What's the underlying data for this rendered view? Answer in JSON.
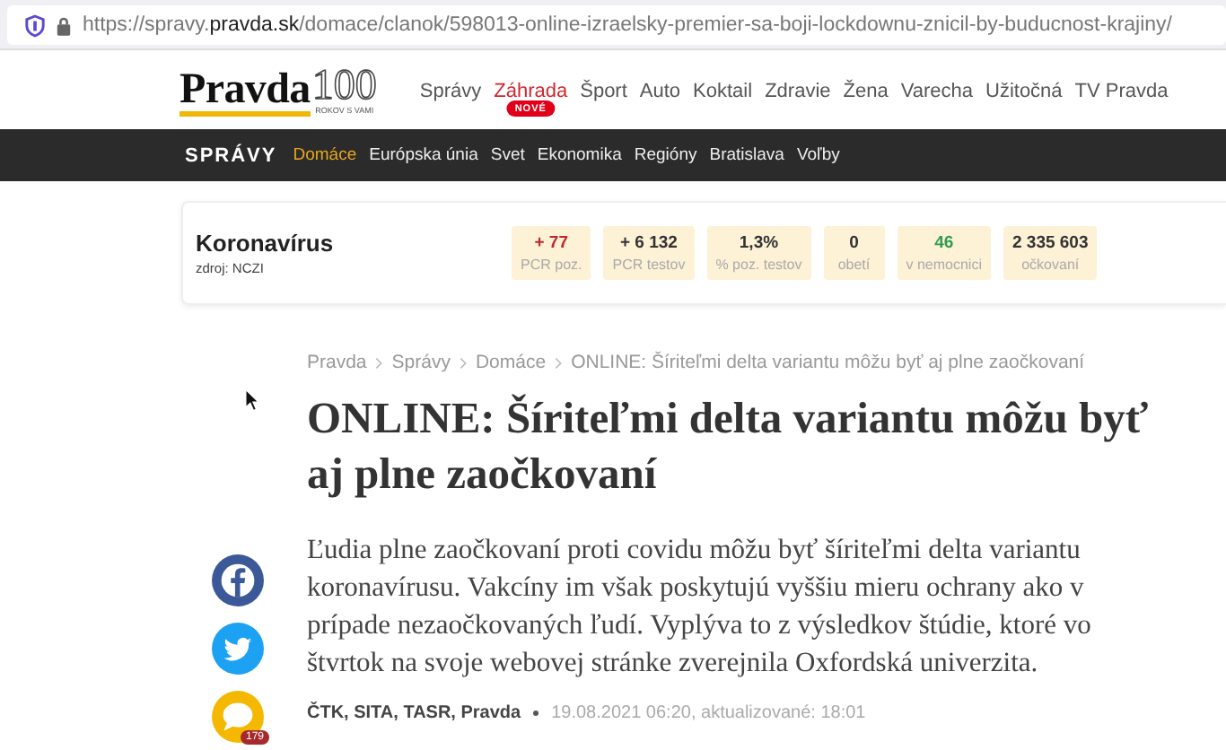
{
  "browser": {
    "url_host_prefix": "https://spravy.",
    "url_host": "pravda.sk",
    "url_path": "/domace/clanok/598013-online-izraelsky-premier-sa-boji-lockdownu-znicil-by-buducnost-krajiny/"
  },
  "logo": {
    "name": "Pravda",
    "number": "100",
    "tagline": "ROKOV S VAMI"
  },
  "nav": [
    {
      "label": "Správy",
      "highlighted": false
    },
    {
      "label": "Záhrada",
      "highlighted": true,
      "badge": "NOVÉ"
    },
    {
      "label": "Šport",
      "highlighted": false
    },
    {
      "label": "Auto",
      "highlighted": false
    },
    {
      "label": "Koktail",
      "highlighted": false
    },
    {
      "label": "Zdravie",
      "highlighted": false
    },
    {
      "label": "Žena",
      "highlighted": false
    },
    {
      "label": "Varecha",
      "highlighted": false
    },
    {
      "label": "Užitočná",
      "highlighted": false
    },
    {
      "label": "TV Pravda",
      "highlighted": false
    }
  ],
  "section": {
    "title": "SPRÁVY",
    "items": [
      {
        "label": "Domáce",
        "selected": true
      },
      {
        "label": "Európska únia",
        "selected": false
      },
      {
        "label": "Svet",
        "selected": false
      },
      {
        "label": "Ekonomika",
        "selected": false
      },
      {
        "label": "Regióny",
        "selected": false
      },
      {
        "label": "Bratislava",
        "selected": false
      },
      {
        "label": "Voľby",
        "selected": false
      }
    ]
  },
  "corona": {
    "title": "Koronavírus",
    "source": "zdroj: NCZI",
    "stats": [
      {
        "value": "+ 77",
        "label": "PCR poz.",
        "color": "#c0262d"
      },
      {
        "value": "+ 6 132",
        "label": "PCR testov",
        "color": "#333333"
      },
      {
        "value": "1,3%",
        "label": "% poz. testov",
        "color": "#333333"
      },
      {
        "value": "0",
        "label": "obetí",
        "color": "#333333"
      },
      {
        "value": "46",
        "label": "v nemocnici",
        "color": "#2e9c4f"
      },
      {
        "value": "2 335 603",
        "label": "očkovaní",
        "color": "#333333"
      }
    ]
  },
  "breadcrumb": [
    "Pravda",
    "Správy",
    "Domáce",
    "ONLINE: Šíriteľmi delta variantu môžu byť aj plne zaočkovaní"
  ],
  "article": {
    "title": "ONLINE: Šíriteľmi delta variantu môžu byť aj plne zaočkovaní",
    "lead": "Ľudia plne zaočkovaní proti covidu môžu byť šíriteľmi delta variantu koronavírusu. Vakcíny im však poskytujú vyššiu mieru ochrany ako v prípade nezaočkovaných ľudí. Vyplýva to z výsledkov štúdie, ktoré vo štvrtok na svoje webovej stránke zverejnila Oxfordská univerzita.",
    "authors": "ČTK, SITA, TASR, Pravda",
    "date": "19.08.2021 06:20, aktualizované: 18:01"
  },
  "share": {
    "comment_count": "179"
  }
}
